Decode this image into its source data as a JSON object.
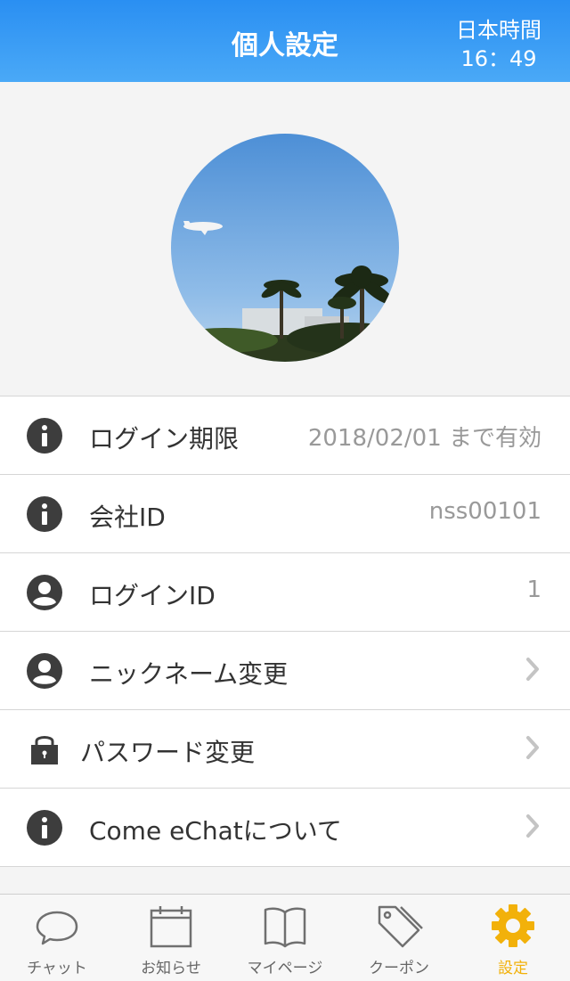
{
  "header": {
    "title": "個人設定",
    "clock_label": "日本時間",
    "clock_time": "16：49"
  },
  "profile": {
    "avatar_icon": "profile-photo-airplane-palms"
  },
  "settings": {
    "rows": [
      {
        "label": "ログイン期限",
        "value": "2018/02/01 まで有効",
        "icon": "info-icon"
      },
      {
        "label": "会社ID",
        "value": "nss00101",
        "icon": "info-icon"
      },
      {
        "label": "ログインID",
        "value": "1",
        "icon": "user-icon"
      },
      {
        "label": "ニックネーム変更",
        "icon": "user-icon"
      },
      {
        "label": "パスワード変更",
        "icon": "lock-icon"
      },
      {
        "label": "Come eChatについて",
        "icon": "info-icon"
      }
    ]
  },
  "tabbar": {
    "tabs": [
      {
        "label": "チャット",
        "icon": "speech-bubble-icon"
      },
      {
        "label": "お知らせ",
        "icon": "calendar-icon"
      },
      {
        "label": "マイページ",
        "icon": "book-icon"
      },
      {
        "label": "クーポン",
        "icon": "tag-icon"
      },
      {
        "label": "設定",
        "icon": "gear-icon",
        "active": true
      }
    ]
  },
  "colors": {
    "header": "#2a8ff2",
    "active_tab": "#f2b10a",
    "icon_dark": "#3d3d3d"
  }
}
